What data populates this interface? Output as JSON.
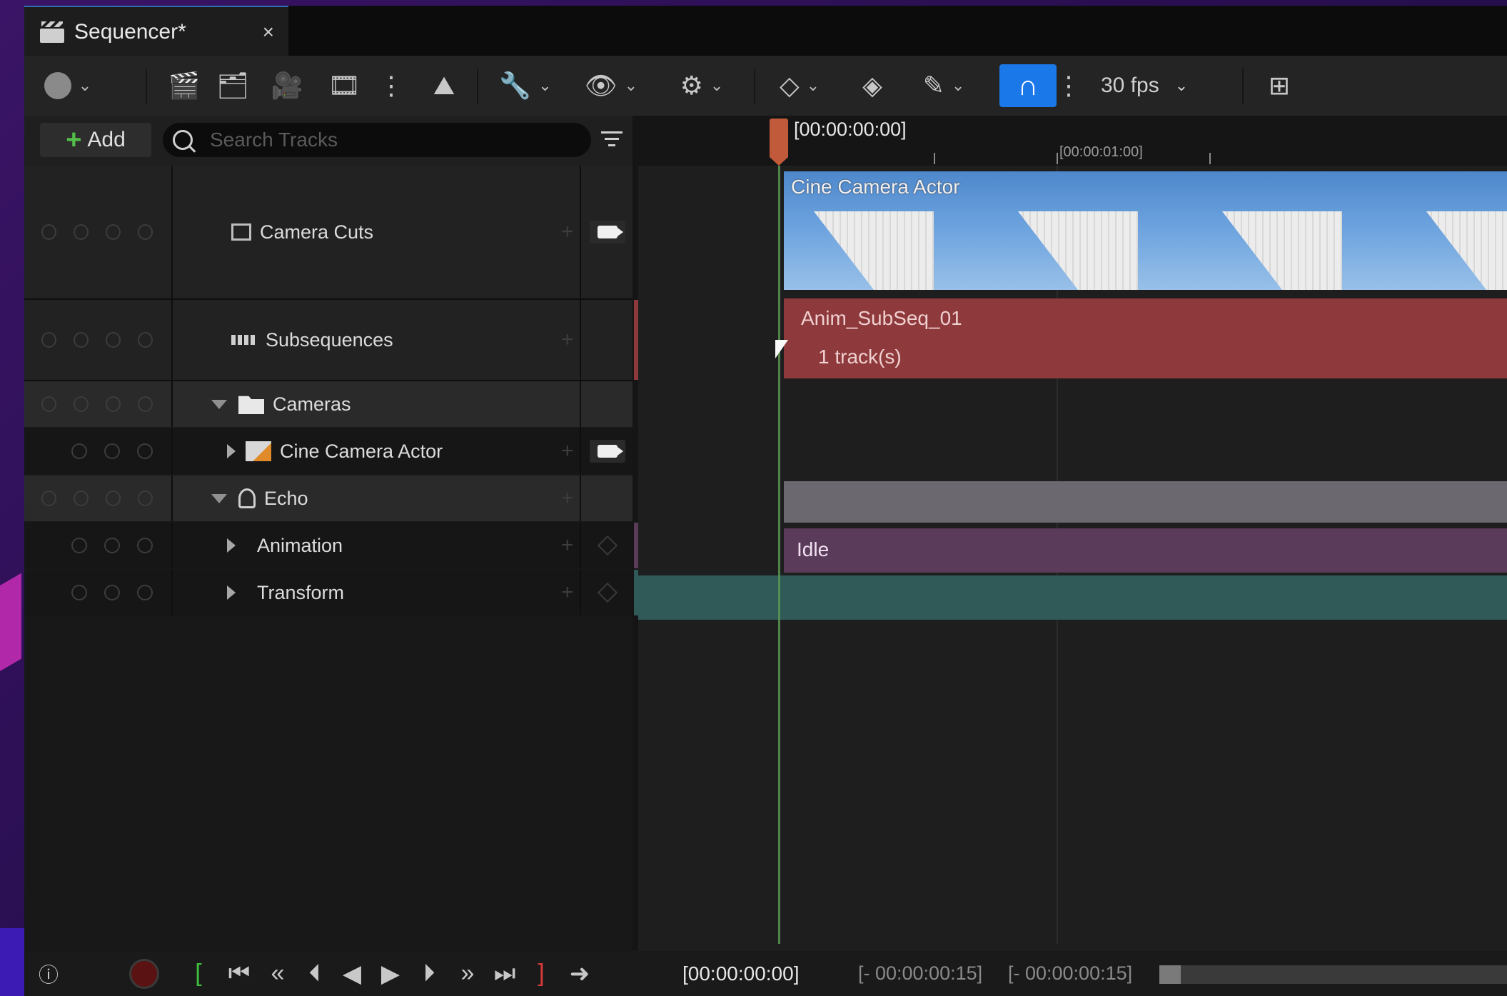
{
  "tab": {
    "title": "Sequencer*",
    "close": "×"
  },
  "toolbar": {
    "fps": "30 fps"
  },
  "left": {
    "add_label": "Add",
    "search_placeholder": "Search Tracks",
    "tracks": [
      {
        "name": "Camera Cuts"
      },
      {
        "name": "Subsequences"
      },
      {
        "name": "Cameras"
      },
      {
        "name": "Cine Camera Actor"
      },
      {
        "name": "Echo"
      },
      {
        "name": "Animation"
      },
      {
        "name": "Transform"
      }
    ]
  },
  "timeline": {
    "current_time": "[00:00:00:00]",
    "tick_one_second": "[00:00:01:00]",
    "sections": {
      "camera": "Cine Camera Actor",
      "subseq_name": "Anim_SubSeq_01",
      "subseq_tracks": "1 track(s)",
      "idle": "Idle"
    }
  },
  "bottom": {
    "time": "[00:00:00:00]",
    "range_start": "[- 00:00:00:15]",
    "range_end": "[- 00:00:00:15]"
  },
  "colors": {
    "snap_accent": "#1a78e8",
    "playhead": "#c15a3a",
    "subsequence": "#8e3a3c",
    "animation": "#5a3b5a",
    "transform": "#2f5a58"
  }
}
